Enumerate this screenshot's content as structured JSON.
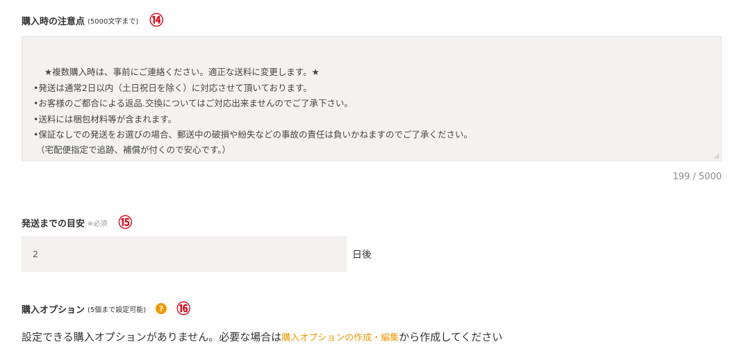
{
  "notes_section": {
    "label": "購入時の注意点",
    "sublabel": "(5000文字まで)",
    "marker": "⑭",
    "text": "★複数購入時は、事前にご連絡ください。適正な送料に変更します。★\n•発送は通常2日以内（土日祝日を除く）に対応させて頂いております。\n•お客様のご都合による返品.交換についてはご対応出来ませんのでご了承下さい。\n•送料には梱包材料等が含まれます。\n•保証なしでの発送をお選びの場合、郵送中の破損や紛失などの事故の責任は負いかねますのでご了承ください。\n （宅配便指定で追跡、補償が付くので安心です。）",
    "char_count": "199 / 5000"
  },
  "shipping_section": {
    "label": "発送までの目安",
    "required_note": "※必須",
    "marker": "⑮",
    "days_value": "2",
    "unit": "日後"
  },
  "options_section": {
    "label": "購入オプション",
    "sublabel": "(5個まで設定可能)",
    "help_icon": "?",
    "marker": "⑯",
    "message_prefix": "設定できる購入オプションがありません。必要な場合は",
    "link_text": "購入オプションの作成・編集",
    "message_suffix": "から作成してください"
  },
  "colors": {
    "accent": "#f39800",
    "marker_red": "#e60012",
    "field_bg": "#f3f2f1"
  }
}
